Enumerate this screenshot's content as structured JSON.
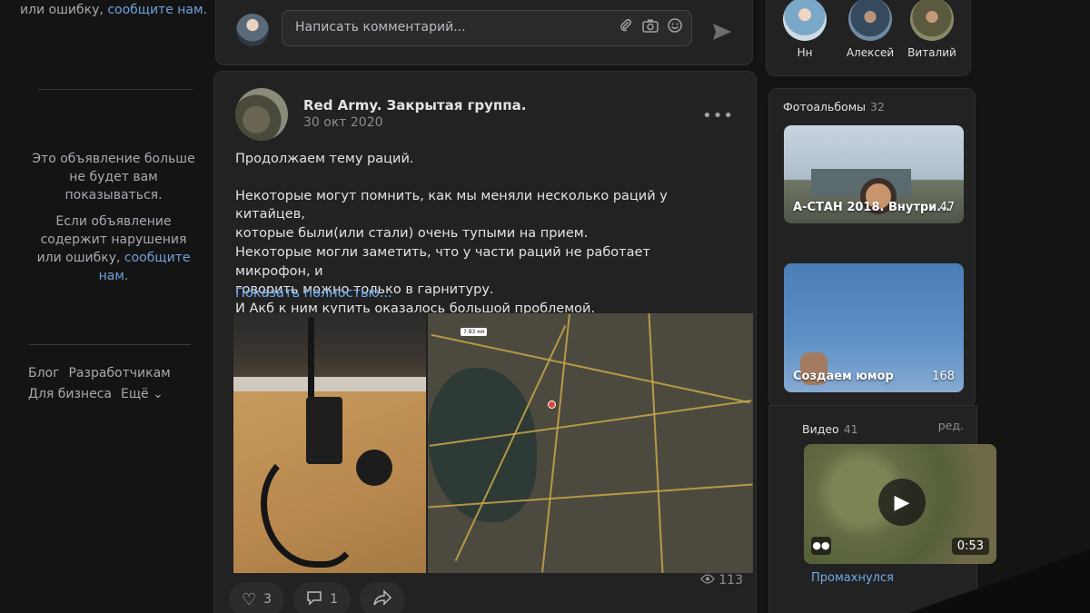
{
  "left_ad": {
    "top_text": "или ошибку,",
    "top_link": "сообщите нам.",
    "hidden_text": "Это объявление больше не будет вам показываться.",
    "violation_text": "Если объявление содержит нарушения или ошибку,",
    "violation_link": "сообщите нам."
  },
  "footer": {
    "blog": "Блог",
    "developers": "Разработчикам",
    "business": "Для бизнеса",
    "more": "Ещё ⌄"
  },
  "comment": {
    "placeholder": "Написать комментарий...",
    "icons": [
      "attach-icon",
      "camera-icon",
      "emoji-icon"
    ],
    "send_icon": "send-icon"
  },
  "post": {
    "author": "Red Army. Закрытая группа.",
    "date": "30 окт 2020",
    "text_lines": [
      "Продолжаем тему раций.",
      "",
      "Некоторые могут помнить, как мы меняли несколько раций у китайцев,",
      "которые были(или стали) очень тупыми на прием.",
      "Некоторые могли заметить, что у части раций не работает микрофон, и",
      "говорить можно только в гарнитуру.",
      "И Акб к ним купить оказалось большой проблемой."
    ],
    "show_more": "Показать полностью...",
    "views": "113",
    "likes": "3",
    "comments": "1",
    "map_label": "7.83 км"
  },
  "friends": [
    {
      "name": "Нн"
    },
    {
      "name": "Алексей"
    },
    {
      "name": "Виталий"
    }
  ],
  "albums": {
    "title": "Фотоальбомы",
    "count": "32",
    "items": [
      {
        "name": "А-СТАН 2018. Внутри...",
        "count": "47"
      },
      {
        "name": "Создаем юмор",
        "count": "168"
      }
    ]
  },
  "videos": {
    "title": "Видео",
    "count": "41",
    "edit": "ред.",
    "item": {
      "title": "Промахнулся",
      "duration": "0:53"
    }
  }
}
